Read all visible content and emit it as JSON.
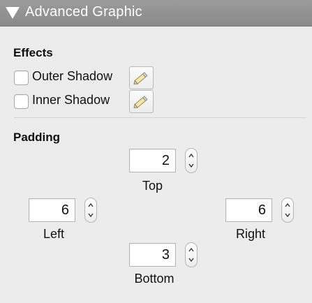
{
  "panel": {
    "title": "Advanced Graphic"
  },
  "effects": {
    "heading": "Effects",
    "items": [
      {
        "label": "Outer Shadow",
        "checked": false
      },
      {
        "label": "Inner Shadow",
        "checked": false
      }
    ]
  },
  "padding": {
    "heading": "Padding",
    "top": {
      "label": "Top",
      "value": "2"
    },
    "left": {
      "label": "Left",
      "value": "6"
    },
    "right": {
      "label": "Right",
      "value": "6"
    },
    "bottom": {
      "label": "Bottom",
      "value": "3"
    }
  },
  "icons": {
    "disclosure": "disclosure-triangle-icon",
    "edit": "pencil-icon",
    "stepper": "up-down-arrows-icon"
  }
}
